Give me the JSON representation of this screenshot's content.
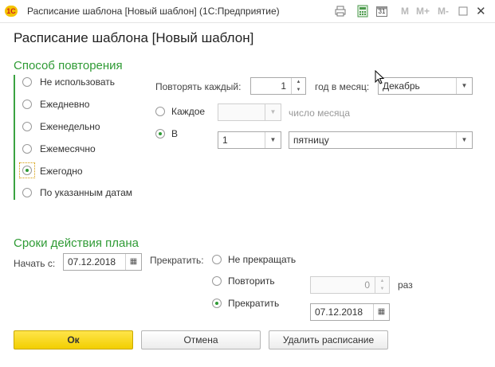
{
  "window": {
    "title": "Расписание шаблона [Новый шаблон]  (1С:Предприятие)",
    "logo_text": "1С",
    "toolbar_m": [
      "M",
      "M+",
      "M-"
    ],
    "calendar_day": "31",
    "close_icon": "close-icon"
  },
  "heading": "Расписание шаблона [Новый шаблон]",
  "repeat": {
    "section_title": "Способ повторения",
    "options": [
      "Не использовать",
      "Ежедневно",
      "Еженедельно",
      "Ежемесячно",
      "Ежегодно",
      "По указанным датам"
    ],
    "selected": "Ежегодно",
    "repeat_every_label": "Повторять каждый:",
    "repeat_every_value": "1",
    "year_in_month_label": "год в месяц:",
    "month_value": "Декабрь",
    "every_label": "Каждое",
    "every_value": "",
    "day_of_month_label": "число месяца",
    "in_label": "В",
    "week_number_value": "1",
    "weekday_value": "пятницу"
  },
  "terms": {
    "section_title": "Сроки действия плана",
    "start_label": "Начать с:",
    "start_date": "07.12.2018",
    "stop_label": "Прекратить:",
    "stop_options": [
      "Не прекращать",
      "Повторить",
      "Прекратить"
    ],
    "stop_selected": "Прекратить",
    "repeat_count": "0",
    "times_label": "раз",
    "stop_date": "07.12.2018"
  },
  "buttons": {
    "ok": "Ок",
    "cancel": "Отмена",
    "delete": "Удалить расписание"
  }
}
